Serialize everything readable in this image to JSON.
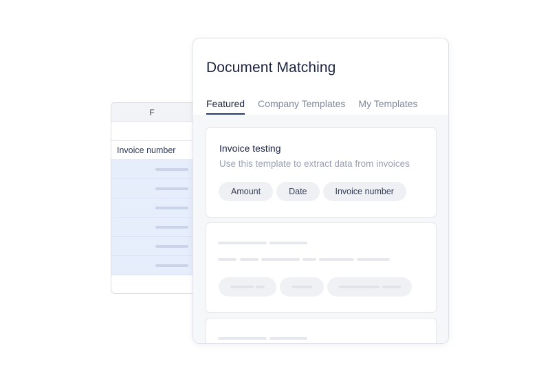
{
  "spreadsheet": {
    "column_header": "F",
    "label_cell": "Invoice number",
    "row_count": 6
  },
  "panel": {
    "title": "Document Matching",
    "tabs": [
      {
        "label": "Featured",
        "active": true
      },
      {
        "label": "Company Templates",
        "active": false
      },
      {
        "label": "My Templates",
        "active": false
      }
    ],
    "templates": [
      {
        "name": "Invoice testing",
        "description": "Use this template to extract data from invoices",
        "fields": [
          "Amount",
          "Date",
          "Invoice number"
        ]
      }
    ]
  },
  "colors": {
    "accent": "#243a73",
    "title": "#1d2440",
    "muted": "#7f879b",
    "highlight_rows": "#e6edfb",
    "chip_bg": "#eef0f4"
  }
}
